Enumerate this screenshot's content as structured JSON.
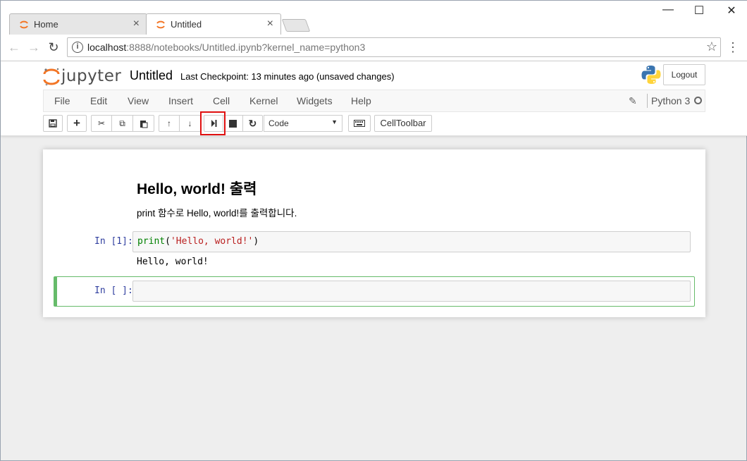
{
  "browser": {
    "tabs": [
      {
        "label": "Home",
        "close": "×"
      },
      {
        "label": "Untitled",
        "close": "×"
      }
    ],
    "window_controls": {
      "minimize": "—",
      "maximize": "☐",
      "close": "✕"
    },
    "url_host": "localhost",
    "url_rest": ":8888/notebooks/Untitled.ipynb?kernel_name=python3",
    "back": "←",
    "forward": "→",
    "reload": "↻",
    "bookmark": "☆",
    "menu": "⋮",
    "info": "i"
  },
  "jupyter": {
    "logo_text": "jupyter",
    "notebook_title": "Untitled",
    "checkpoint": "Last Checkpoint: 13 minutes ago (unsaved changes)",
    "logout": "Logout",
    "menu": [
      "File",
      "Edit",
      "View",
      "Insert",
      "Cell",
      "Kernel",
      "Widgets",
      "Help"
    ],
    "kernel_name": "Python 3",
    "toolbar": {
      "save": "💾",
      "add": "+",
      "cut": "✂",
      "copy": "⧉",
      "paste": "📋",
      "up": "🡡",
      "down": "🡣",
      "run": "⏭",
      "stop": "■",
      "restart": "↻",
      "cell_type": "Code",
      "keyboard": "⌨",
      "celltoolbar": "CellToolbar"
    }
  },
  "notebook": {
    "md_heading": "Hello, world! 출력",
    "md_paragraph": "print 함수로 Hello, world!를 출력합니다.",
    "cell1_prompt": "In [1]:",
    "cell1_fn": "print",
    "cell1_open": "(",
    "cell1_str": "'Hello, world!'",
    "cell1_close": ")",
    "cell1_output": "Hello, world!",
    "cell2_prompt": "In [ ]:"
  },
  "colors": {
    "accent_orange": "#f37626",
    "selected_cell": "#66bb6a",
    "highlight": "#e01010"
  }
}
